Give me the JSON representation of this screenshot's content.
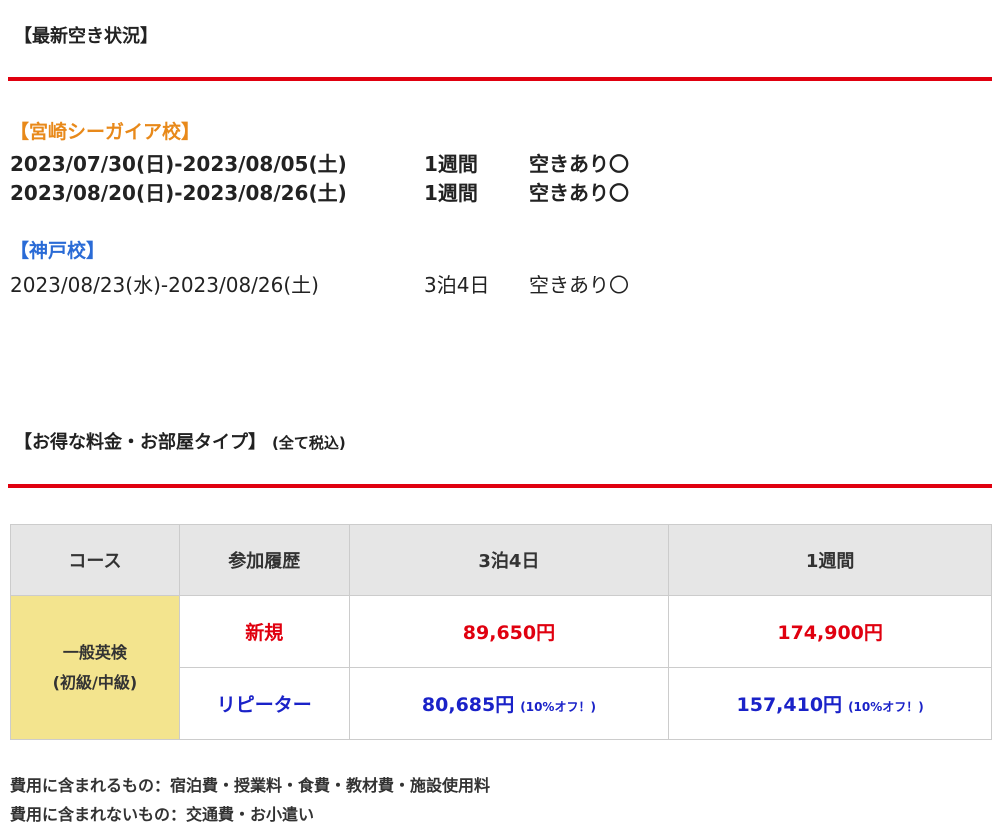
{
  "availability": {
    "heading": "【最新空き状況】",
    "schools": [
      {
        "name": "【宮崎シーガイア校】",
        "color": "#e8891a",
        "rows": [
          {
            "dates": "2023/07/30(日)-2023/08/05(土)",
            "period": "1週間",
            "status": "空きあり〇"
          },
          {
            "dates": "2023/08/20(日)-2023/08/26(土)",
            "period": "1週間",
            "status": "空きあり〇"
          }
        ]
      },
      {
        "name": "【神戸校】",
        "color": "#2a6bd6",
        "rows": [
          {
            "dates": "2023/08/23(水)-2023/08/26(土)",
            "period": "3泊4日",
            "status": "空きあり〇"
          }
        ]
      }
    ]
  },
  "pricing": {
    "heading": "【お得な料金・お部屋タイプ】",
    "note": "(全て税込)",
    "table": {
      "headers": [
        "コース",
        "参加履歴",
        "3泊4日",
        "1週間"
      ],
      "course_line1": "一般英検",
      "course_line2": "(初級/中級)",
      "rows": [
        {
          "history": "新規",
          "price_3n4d": "89,650円",
          "discount_3n4d": "",
          "price_1w": "174,900円",
          "discount_1w": ""
        },
        {
          "history": "リピーター",
          "price_3n4d": "80,685円",
          "discount_3n4d": "(10%オフ！)",
          "price_1w": "157,410円",
          "discount_1w": "(10%オフ！)"
        }
      ]
    },
    "included": "費用に含まれるもの：宿泊費・授業料・食費・教材費・施設使用料",
    "excluded": "費用に含まれないもの：交通費・お小遣い"
  },
  "colors": {
    "rule": "#e0000f",
    "new_price": "#e0000f",
    "repeater_price": "#1a22c8",
    "course_bg": "#f3e48e",
    "header_bg": "#e6e6e6"
  }
}
